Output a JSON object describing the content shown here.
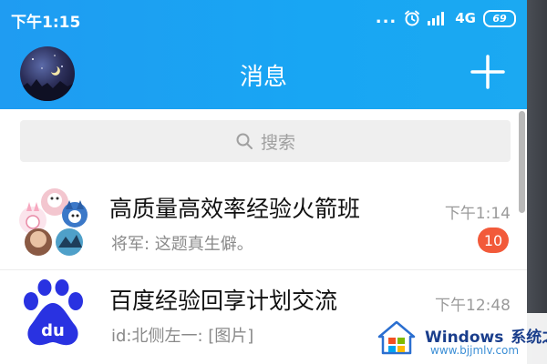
{
  "status_bar": {
    "time": "下午1:15",
    "dots": "...",
    "network": "4G",
    "battery": "69"
  },
  "header": {
    "title": "消息"
  },
  "search": {
    "placeholder": "搜索"
  },
  "conversations": [
    {
      "title": "高质量高效率经验火箭班",
      "preview": "将军: 这题真生僻。",
      "time": "下午1:14",
      "unread": "10"
    },
    {
      "title": "百度经验回享计划交流",
      "preview": "id:北侧左一: [图片]",
      "time": "下午12:48",
      "avatar_text": "du"
    }
  ],
  "watermark": {
    "brand": "Windows",
    "brand_cn": "系统之家",
    "url": "www.bjjmlv.com"
  },
  "colors": {
    "header_blue": "#1f9cf2",
    "badge_red": "#f25a3a",
    "baidu_blue": "#2932e1"
  }
}
